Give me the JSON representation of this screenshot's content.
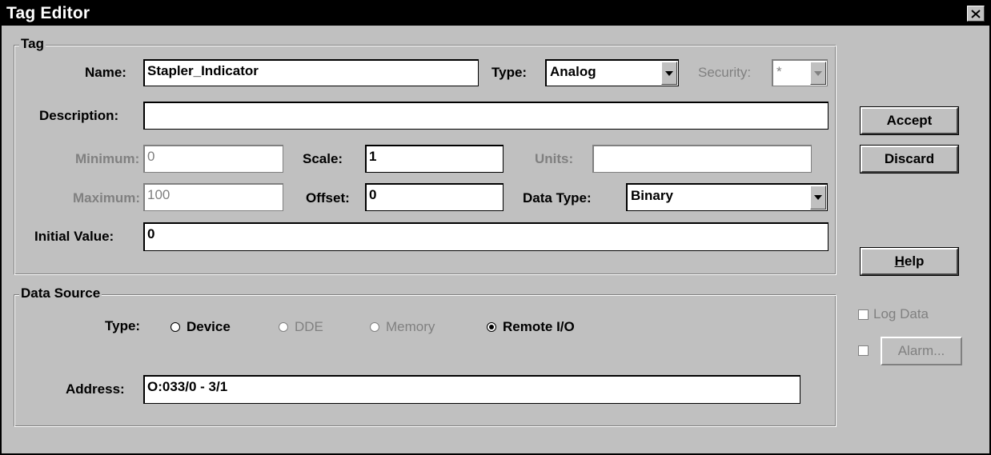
{
  "window": {
    "title": "Tag Editor"
  },
  "tag_group": {
    "label": "Tag",
    "name_label": "Name:",
    "name_value": "Stapler_Indicator",
    "type_label": "Type:",
    "type_value": "Analog",
    "security_label": "Security:",
    "security_value": "*",
    "description_label": "Description:",
    "description_value": "",
    "minimum_label": "Minimum:",
    "minimum_value": "0",
    "scale_label": "Scale:",
    "scale_value": "1",
    "units_label": "Units:",
    "units_value": "",
    "maximum_label": "Maximum:",
    "maximum_value": "100",
    "offset_label": "Offset:",
    "offset_value": "0",
    "data_type_label": "Data Type:",
    "data_type_value": "Binary",
    "initial_value_label": "Initial Value:",
    "initial_value_value": "0"
  },
  "data_source": {
    "label": "Data Source",
    "type_label": "Type:",
    "options": [
      "Device",
      "DDE",
      "Memory",
      "Remote I/O"
    ],
    "selected": "Remote I/O",
    "address_label": "Address:",
    "address_value": "O:033/0 - 3/1"
  },
  "buttons": {
    "accept": "Accept",
    "discard": "Discard",
    "help_prefix": "H",
    "help_rest": "elp",
    "alarm": "Alarm..."
  },
  "checkboxes": {
    "log_data": "Log Data"
  }
}
